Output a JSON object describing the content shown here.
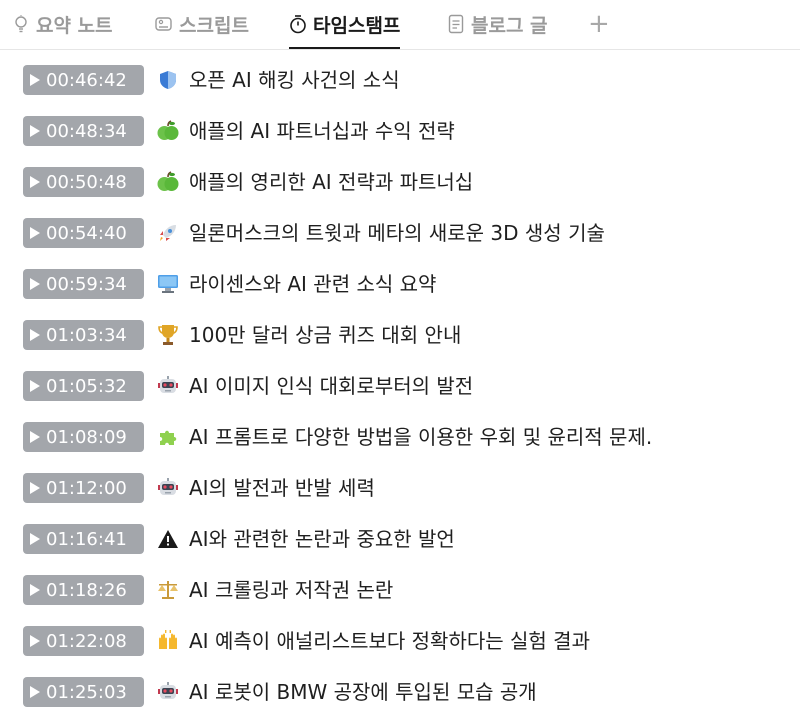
{
  "tabs": [
    {
      "label": "요약 노트",
      "icon": "lightbulb-icon",
      "active": false
    },
    {
      "label": "스크립트",
      "icon": "script-icon",
      "active": false
    },
    {
      "label": "타임스탬프",
      "icon": "stopwatch-icon",
      "active": true
    },
    {
      "label": "블로그 글",
      "icon": "document-icon",
      "active": false
    }
  ],
  "add_tab_label": "+",
  "entries": [
    {
      "time": "00:46:42",
      "icon": "shield-icon",
      "title": "오픈 AI 해킹 사건의 소식"
    },
    {
      "time": "00:48:34",
      "icon": "green-apple-icon",
      "title": "애플의 AI 파트너십과 수익 전략"
    },
    {
      "time": "00:50:48",
      "icon": "green-apple-icon",
      "title": "애플의 영리한 AI 전략과 파트너십"
    },
    {
      "time": "00:54:40",
      "icon": "rocket-icon",
      "title": "일론머스크의 트윗과 메타의 새로운 3D 생성 기술"
    },
    {
      "time": "00:59:34",
      "icon": "computer-monitor-icon",
      "title": "라이센스와 AI 관련 소식 요약"
    },
    {
      "time": "01:03:34",
      "icon": "trophy-icon",
      "title": "100만 달러 상금 퀴즈 대회 안내"
    },
    {
      "time": "01:05:32",
      "icon": "robot-icon",
      "title": "AI 이미지 인식 대회로부터의 발전"
    },
    {
      "time": "01:08:09",
      "icon": "puzzle-piece-icon",
      "title": "AI 프롬트로 다양한 방법을 이용한 우회 및 윤리적 문제."
    },
    {
      "time": "01:12:00",
      "icon": "robot-icon",
      "title": "AI의 발전과 반발 세력"
    },
    {
      "time": "01:16:41",
      "icon": "warning-icon",
      "title": "AI와 관련한 논란과 중요한 발언"
    },
    {
      "time": "01:18:26",
      "icon": "balance-scale-icon",
      "title": "AI 크롤링과 저작권 논란"
    },
    {
      "time": "01:22:08",
      "icon": "raising-hands-icon",
      "title": "AI 예측이 애널리스트보다 정확하다는 실험 결과"
    },
    {
      "time": "01:25:03",
      "icon": "robot-icon",
      "title": "AI 로봇이 BMW 공장에 투입된 모습 공개"
    }
  ],
  "colors": {
    "timestamp_button": "#a3a6ab",
    "active_tab": "#1a1a1a",
    "inactive_tab": "#9a9a9a"
  }
}
